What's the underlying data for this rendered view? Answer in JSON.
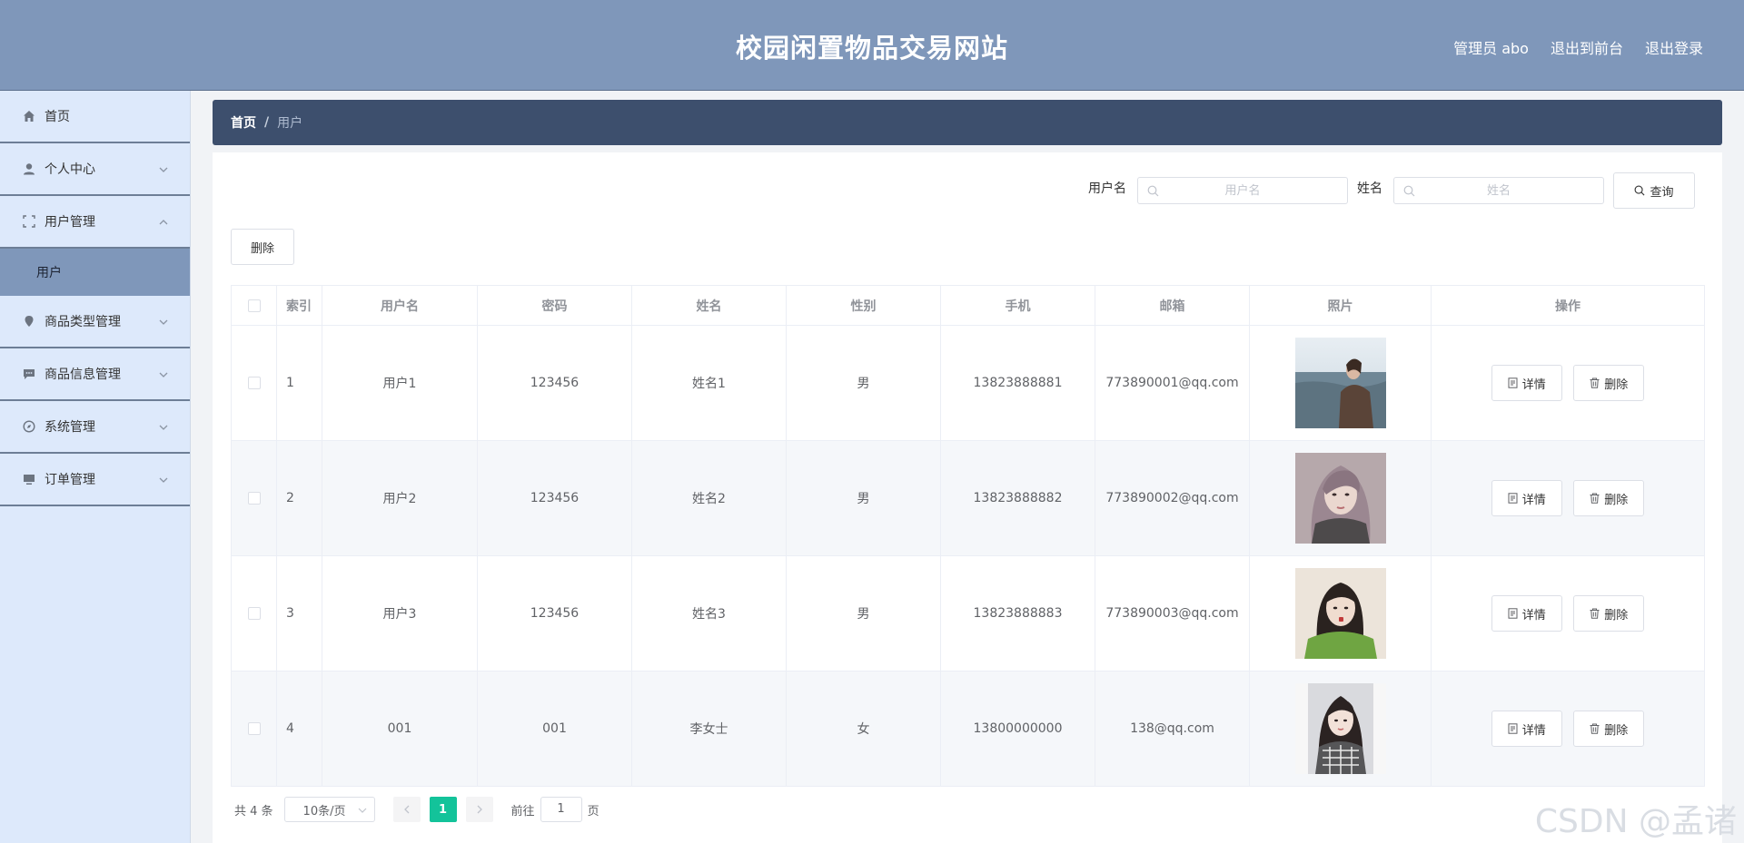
{
  "header": {
    "title": "校园闲置物品交易网站",
    "links": [
      "管理员 abo",
      "退出到前台",
      "退出登录"
    ]
  },
  "sidebar": {
    "items": [
      {
        "label": "首页",
        "icon": "home-icon"
      },
      {
        "label": "个人中心",
        "icon": "user-icon"
      },
      {
        "label": "用户管理",
        "icon": "frame-icon",
        "expanded": true,
        "sub": "用户"
      },
      {
        "label": "商品类型管理",
        "icon": "location-icon"
      },
      {
        "label": "商品信息管理",
        "icon": "chat-icon"
      },
      {
        "label": "系统管理",
        "icon": "compass-icon"
      },
      {
        "label": "订单管理",
        "icon": "monitor-icon"
      }
    ]
  },
  "breadcrumb": {
    "home": "首页",
    "sep": "/",
    "current": "用户"
  },
  "search": {
    "username_label": "用户名",
    "username_placeholder": "用户名",
    "name_label": "姓名",
    "name_placeholder": "姓名",
    "query_button": "查询"
  },
  "toolbar": {
    "delete_label": "删除"
  },
  "table": {
    "headers": [
      "索引",
      "用户名",
      "密码",
      "姓名",
      "性别",
      "手机",
      "邮箱",
      "照片",
      "操作"
    ],
    "rows": [
      {
        "index": "1",
        "username": "用户1",
        "password": "123456",
        "name": "姓名1",
        "gender": "男",
        "phone": "13823888881",
        "email": "773890001@qq.com"
      },
      {
        "index": "2",
        "username": "用户2",
        "password": "123456",
        "name": "姓名2",
        "gender": "男",
        "phone": "13823888882",
        "email": "773890002@qq.com"
      },
      {
        "index": "3",
        "username": "用户3",
        "password": "123456",
        "name": "姓名3",
        "gender": "男",
        "phone": "13823888883",
        "email": "773890003@qq.com"
      },
      {
        "index": "4",
        "username": "001",
        "password": "001",
        "name": "李女士",
        "gender": "女",
        "phone": "13800000000",
        "email": "138@qq.com"
      }
    ],
    "detail_label": "详情",
    "delete_label": "删除"
  },
  "pagination": {
    "total": "共 4 条",
    "page_size": "10条/页",
    "current_page": "1",
    "goto_prefix": "前往",
    "goto_value": "1",
    "goto_suffix": "页"
  },
  "watermark": "CSDN @孟诸",
  "colors": {
    "header": "#7f97ba",
    "sidebar": "#dde9fb",
    "breadcrumb": "#3d4f6d",
    "accent": "#13c39a"
  }
}
